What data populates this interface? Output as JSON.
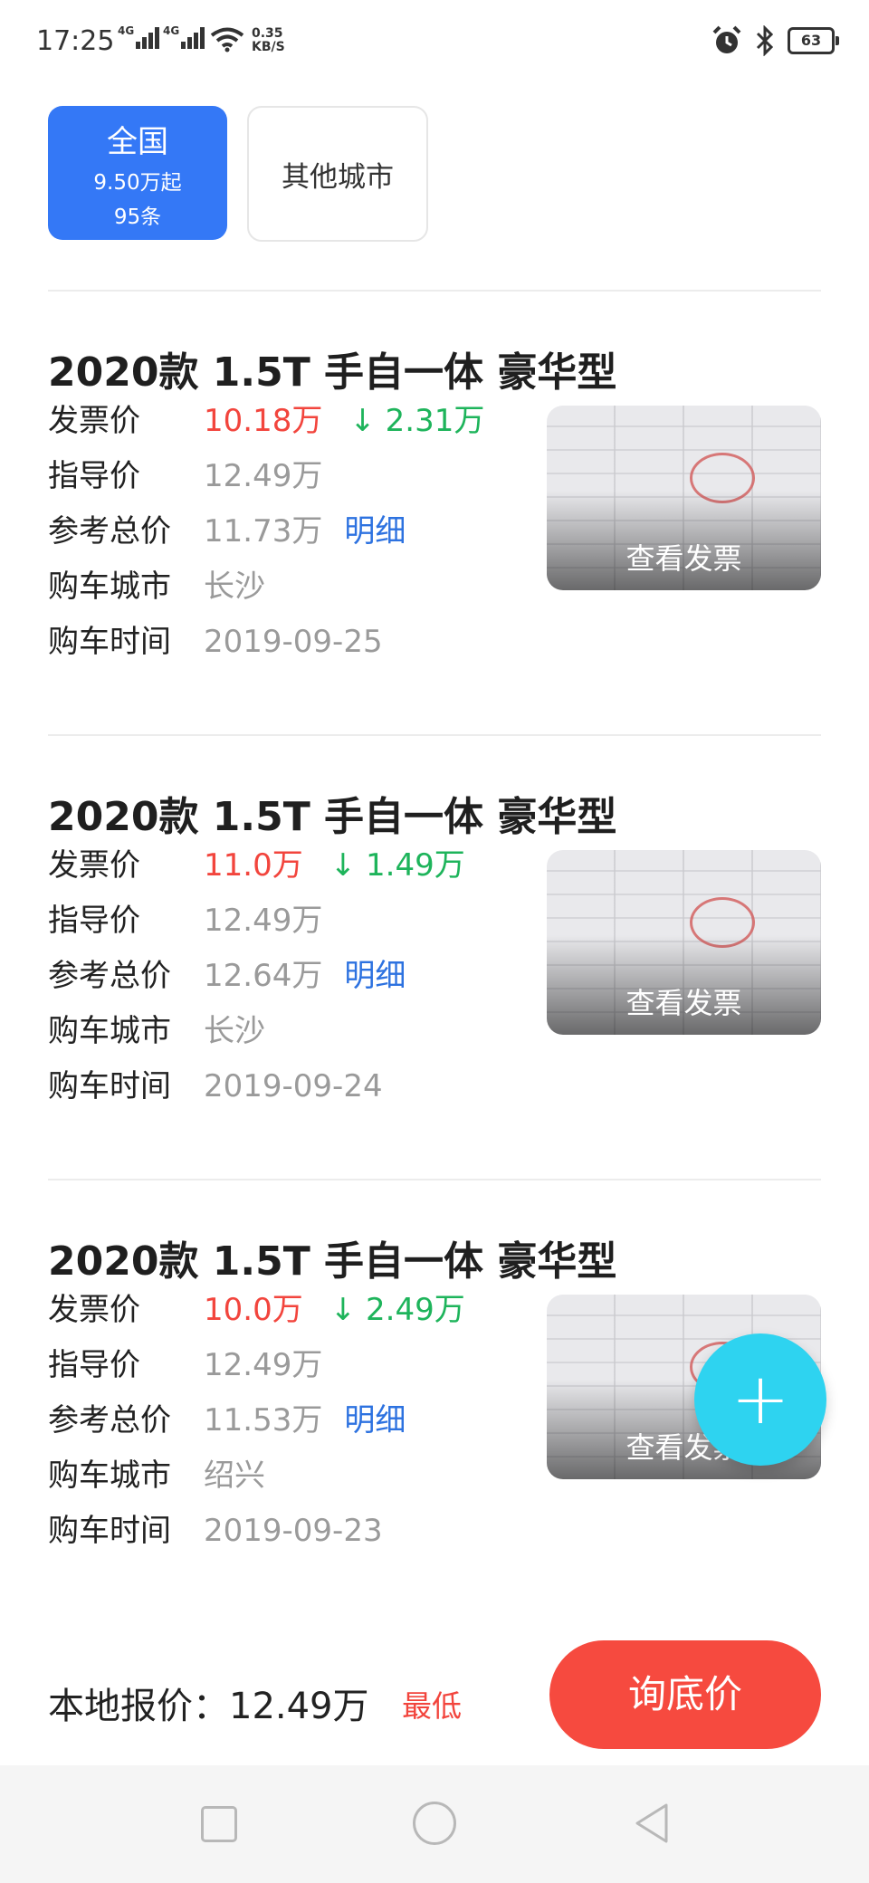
{
  "status_bar": {
    "time": "17:25",
    "network_1": "4G",
    "network_2": "4G",
    "speed_value": "0.35",
    "speed_unit": "KB/S",
    "battery": "63",
    "icons": [
      "signal-icon",
      "signal-icon",
      "wifi-icon",
      "alarm-icon",
      "bluetooth-icon",
      "battery-icon"
    ]
  },
  "filters": {
    "active": {
      "label": "全国",
      "price": "9.50万起",
      "count": "95条"
    },
    "other_label": "其他城市"
  },
  "labels": {
    "invoice_price": "发票价",
    "guide_price": "指导价",
    "reference_total": "参考总价",
    "city": "购车城市",
    "date": "购车时间",
    "detail_link": "明细",
    "view_invoice": "查看发票"
  },
  "records": [
    {
      "title": "2020款 1.5T 手自一体 豪华型",
      "invoice_price": "10.18万",
      "discount": "2.31万",
      "guide_price": "12.49万",
      "reference_total": "11.73万",
      "city": "长沙",
      "date": "2019-09-25"
    },
    {
      "title": "2020款 1.5T 手自一体 豪华型",
      "invoice_price": "11.0万",
      "discount": "1.49万",
      "guide_price": "12.49万",
      "reference_total": "12.64万",
      "city": "长沙",
      "date": "2019-09-24"
    },
    {
      "title": "2020款 1.5T 手自一体 豪华型",
      "invoice_price": "10.0万",
      "discount": "2.49万",
      "guide_price": "12.49万",
      "reference_total": "11.53万",
      "city": "绍兴",
      "date": "2019-09-23"
    }
  ],
  "fab": {
    "symbol": "+",
    "icon": "plus-icon"
  },
  "bottom_bar": {
    "local_price_label": "本地报价：12.49万",
    "badge": "最低",
    "cta": "询底价"
  },
  "colors": {
    "accent_blue": "#3478f6",
    "price_red": "#f2453d",
    "discount_green": "#1eb45b",
    "link_blue": "#2d72e0",
    "fab_cyan": "#2ed3f0",
    "cta_red": "#f64a3f"
  }
}
